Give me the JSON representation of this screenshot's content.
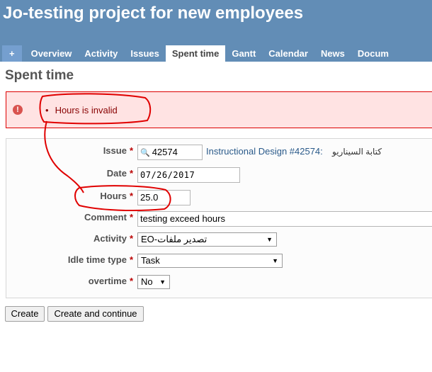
{
  "header": {
    "title": "Jo-testing project for new employees",
    "tabs": [
      {
        "label": "+"
      },
      {
        "label": "Overview"
      },
      {
        "label": "Activity"
      },
      {
        "label": "Issues"
      },
      {
        "label": "Spent time",
        "selected": true
      },
      {
        "label": "Gantt"
      },
      {
        "label": "Calendar"
      },
      {
        "label": "News"
      },
      {
        "label": "Docum"
      }
    ]
  },
  "page": {
    "heading": "Spent time"
  },
  "error": {
    "icon": "error-icon",
    "items": [
      "Hours is invalid"
    ]
  },
  "form": {
    "required_mark": "*",
    "issue": {
      "label": "Issue",
      "value": "42574",
      "link_text": "Instructional Design #42574:",
      "subject": "كتابة السيناريو"
    },
    "date": {
      "label": "Date",
      "value": "07/26/2017"
    },
    "hours": {
      "label": "Hours",
      "value": "25.0"
    },
    "comment": {
      "label": "Comment",
      "value": "testing exceed hours"
    },
    "activity": {
      "label": "Activity",
      "value": "EO-تصدير ملفات"
    },
    "idle_time_type": {
      "label": "Idle time type",
      "value": "Task"
    },
    "overtime": {
      "label": "overtime",
      "value": "No"
    }
  },
  "buttons": {
    "create": "Create",
    "create_continue": "Create and continue"
  },
  "colors": {
    "header": "#628db6",
    "error_bg": "#ffe3e3",
    "error_text": "#880000",
    "annotation": "#e00000"
  }
}
